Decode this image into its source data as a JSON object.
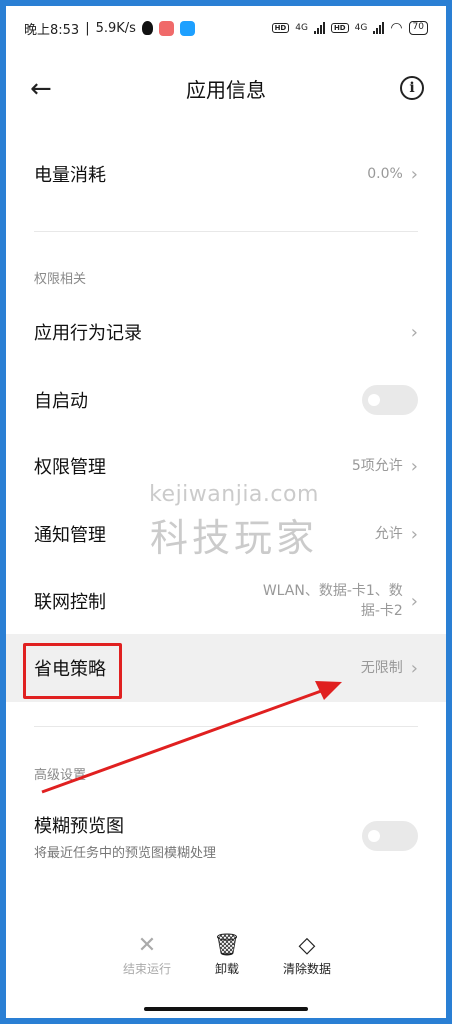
{
  "status_bar": {
    "time": "晚上8:53",
    "separator": "|",
    "speed": "5.9K/s",
    "hd_label": "HD",
    "network": "4G",
    "battery": "70"
  },
  "header": {
    "title": "应用信息"
  },
  "sections": {
    "permissions": "权限相关",
    "advanced": "高级设置"
  },
  "rows": {
    "battery": {
      "label": "电量消耗",
      "value": "0.0%"
    },
    "behavior": {
      "label": "应用行为记录"
    },
    "autostart": {
      "label": "自启动",
      "enabled": false
    },
    "permissions": {
      "label": "权限管理",
      "value": "5项允许"
    },
    "notifications": {
      "label": "通知管理",
      "value": "允许"
    },
    "network": {
      "label": "联网控制",
      "value_line1": "WLAN、数据-卡1、数",
      "value_line2": "据-卡2"
    },
    "battery_saver": {
      "label": "省电策略",
      "value": "无限制"
    },
    "blur_preview": {
      "label": "模糊预览图",
      "description": "将最近任务中的预览图模糊处理",
      "enabled": false
    }
  },
  "watermark": {
    "url": "kejiwanjia.com",
    "text": "科技玩家"
  },
  "actions": {
    "force_stop": "结束运行",
    "uninstall": "卸载",
    "clear_data": "清除数据"
  },
  "colors": {
    "accent_annotation": "#e02020",
    "frame": "#2a7fd4",
    "highlight_row": "#f0f0f0"
  }
}
